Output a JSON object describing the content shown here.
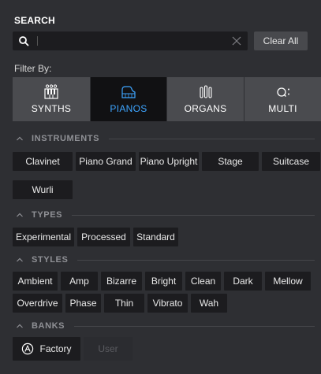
{
  "search": {
    "title": "SEARCH",
    "value": "",
    "placeholder": "",
    "clear_all_label": "Clear All"
  },
  "filter_by_label": "Filter By:",
  "categories": [
    {
      "label": "SYNTHS",
      "icon": "synth-icon",
      "selected": false
    },
    {
      "label": "PIANOS",
      "icon": "piano-icon",
      "selected": true
    },
    {
      "label": "ORGANS",
      "icon": "organ-icon",
      "selected": false
    },
    {
      "label": "MULTI",
      "icon": "multi-icon",
      "selected": false
    }
  ],
  "sections": {
    "instruments": {
      "label": "INSTRUMENTS",
      "items": [
        "Clavinet",
        "Piano Grand",
        "Piano Upright",
        "Stage",
        "Suitcase",
        "Wurli"
      ]
    },
    "types": {
      "label": "TYPES",
      "items": [
        "Experimental",
        "Processed",
        "Standard"
      ]
    },
    "styles": {
      "label": "STYLES",
      "items": [
        "Ambient",
        "Amp",
        "Bizarre",
        "Bright",
        "Clean",
        "Dark",
        "Mellow",
        "Overdrive",
        "Phase",
        "Thin",
        "Vibrato",
        "Wah"
      ]
    },
    "banks": {
      "label": "BANKS",
      "items": [
        "Factory",
        "User"
      ]
    }
  },
  "colors": {
    "background": "#2e2f33",
    "tag_background": "#1c1c1f",
    "selected_accent": "#3ea5ff",
    "section_label": "#8f9095"
  }
}
